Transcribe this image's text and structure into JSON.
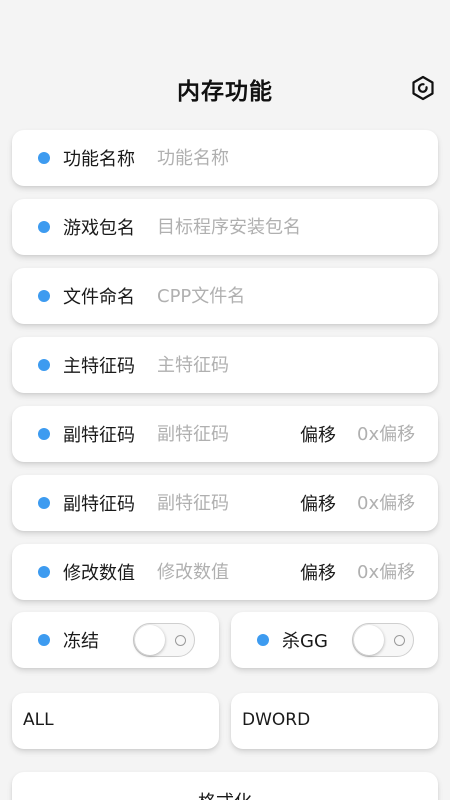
{
  "header": {
    "title": "内存功能",
    "settings_icon": "gear-hexagon-icon"
  },
  "fields": {
    "function_name": {
      "label": "功能名称",
      "placeholder": "功能名称",
      "value": ""
    },
    "package_name": {
      "label": "游戏包名",
      "placeholder": "目标程序安装包名",
      "value": ""
    },
    "file_name": {
      "label": "文件命名",
      "placeholder": "CPP文件名",
      "value": ""
    },
    "main_signature": {
      "label": "主特征码",
      "placeholder": "主特征码",
      "value": ""
    },
    "sub_signature_1": {
      "label": "副特征码",
      "placeholder": "副特征码",
      "value": "",
      "offset_label": "偏移",
      "offset_placeholder": "0x偏移",
      "offset_value": ""
    },
    "sub_signature_2": {
      "label": "副特征码",
      "placeholder": "副特征码",
      "value": "",
      "offset_label": "偏移",
      "offset_placeholder": "0x偏移",
      "offset_value": ""
    },
    "modify_value": {
      "label": "修改数值",
      "placeholder": "修改数值",
      "value": "",
      "offset_label": "偏移",
      "offset_placeholder": "0x偏移",
      "offset_value": ""
    }
  },
  "toggles": {
    "freeze": {
      "label": "冻结",
      "on": false
    },
    "kill_gg": {
      "label": "杀GG",
      "on": false
    }
  },
  "selects": {
    "memory_range": {
      "value": "ALL"
    },
    "value_type": {
      "value": "DWORD"
    }
  },
  "format_button": {
    "label": "格式化"
  },
  "colors": {
    "accent_dot": "#3d9bf0",
    "background": "#f4f4f4",
    "card": "#ffffff",
    "placeholder": "#b0b0b0"
  }
}
